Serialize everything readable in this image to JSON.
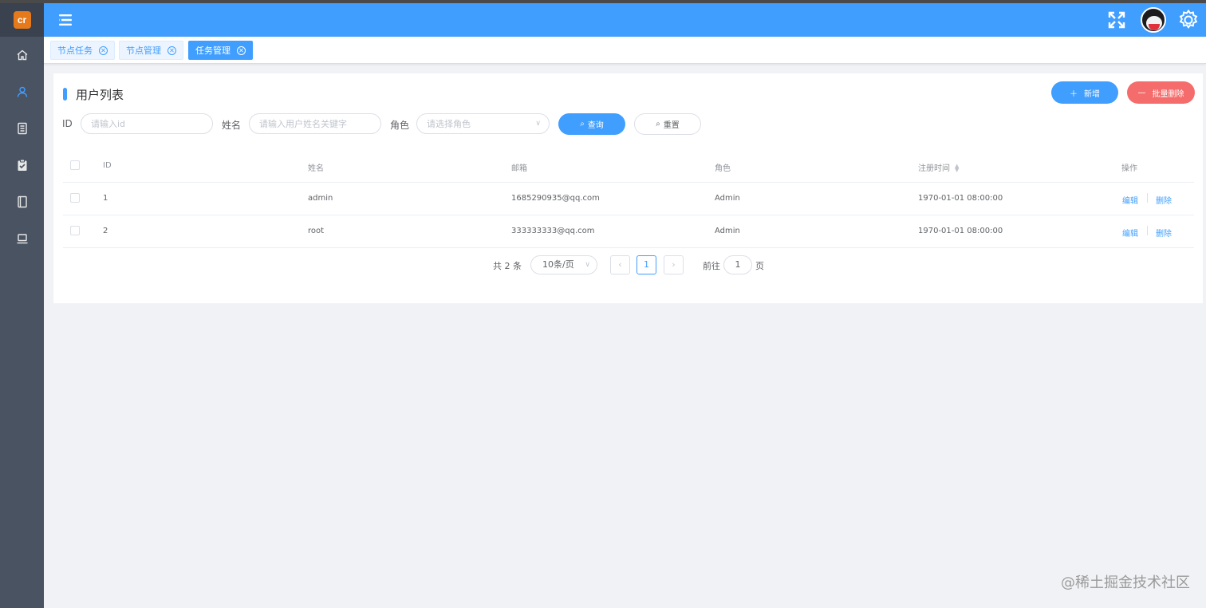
{
  "logo": "cr",
  "tabs": [
    {
      "label": "节点任务"
    },
    {
      "label": "节点管理"
    },
    {
      "label": "任务管理"
    }
  ],
  "page": {
    "title": "用户列表",
    "add_label": "新增",
    "batch_delete_label": "批量删除"
  },
  "filters": {
    "id_label": "ID",
    "id_placeholder": "请输入id",
    "name_label": "姓名",
    "name_placeholder": "请输入用户姓名关键字",
    "role_label": "角色",
    "role_placeholder": "请选择角色",
    "query_label": "查询",
    "reset_label": "重置"
  },
  "table": {
    "headers": {
      "id": "ID",
      "name": "姓名",
      "email": "邮箱",
      "role": "角色",
      "created": "注册时间",
      "actions": "操作"
    },
    "rows": [
      {
        "id": "1",
        "name": "admin",
        "email": "1685290935@qq.com",
        "role": "Admin",
        "created": "1970-01-01 08:00:00",
        "edit": "编辑",
        "delete": "删除"
      },
      {
        "id": "2",
        "name": "root",
        "email": "333333333@qq.com",
        "role": "Admin",
        "created": "1970-01-01 08:00:00",
        "edit": "编辑",
        "delete": "删除"
      }
    ]
  },
  "pagination": {
    "total": "共 2 条",
    "page_size": "10条/页",
    "current": "1",
    "goto": "前往",
    "goto_value": "1",
    "page_suffix": "页"
  },
  "watermark": "@稀土掘金技术社区",
  "colors": {
    "primary": "#409eff",
    "danger": "#f56c6c",
    "sidebar": "#4a5361",
    "logo": "#e6791a"
  }
}
